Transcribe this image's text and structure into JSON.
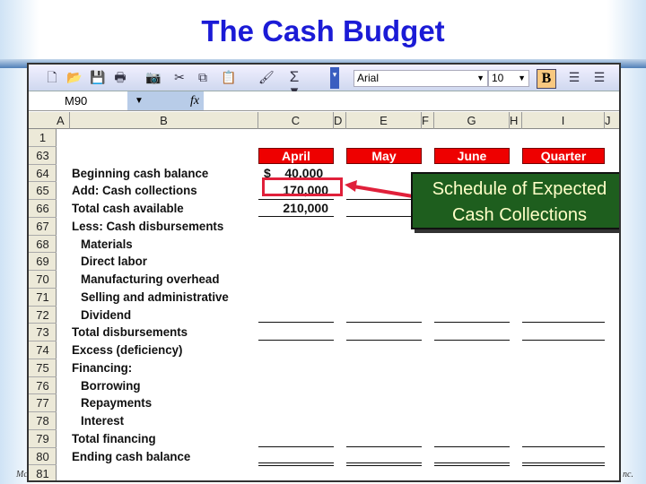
{
  "slide": {
    "title": "The Cash Budget",
    "footer_left": "Mc",
    "footer_right": "nc."
  },
  "toolbar": {
    "font": "Arial",
    "size": "10",
    "bold": "B",
    "icons": [
      "new-icon",
      "open-icon",
      "save-icon",
      "print-icon",
      "camera-icon",
      "cut-icon",
      "copy-icon",
      "paste-icon",
      "format-painter-icon",
      "sum-icon",
      "align-left-icon",
      "align-center-icon"
    ]
  },
  "formula_bar": {
    "name_box": "M90",
    "fx": "fx",
    "value": ""
  },
  "columns": [
    "A",
    "B",
    "C",
    "D",
    "E",
    "F",
    "G",
    "H",
    "I",
    "J"
  ],
  "rows": [
    "1",
    "63",
    "64",
    "65",
    "66",
    "67",
    "68",
    "69",
    "70",
    "71",
    "72",
    "73",
    "74",
    "75",
    "76",
    "77",
    "78",
    "79",
    "80",
    "81"
  ],
  "headers": [
    "April",
    "May",
    "June",
    "Quarter"
  ],
  "labels": [
    {
      "row": 64,
      "text": "Beginning cash balance",
      "indent": 0
    },
    {
      "row": 65,
      "text": "Add: Cash collections",
      "indent": 0
    },
    {
      "row": 66,
      "text": "Total cash available",
      "indent": 0
    },
    {
      "row": 67,
      "text": "Less: Cash disbursements",
      "indent": 0
    },
    {
      "row": 68,
      "text": "Materials",
      "indent": 1
    },
    {
      "row": 69,
      "text": "Direct labor",
      "indent": 1
    },
    {
      "row": 70,
      "text": "Manufacturing overhead",
      "indent": 1
    },
    {
      "row": 71,
      "text": "Selling and administrative",
      "indent": 1
    },
    {
      "row": 72,
      "text": "Dividend",
      "indent": 1
    },
    {
      "row": 73,
      "text": "Total disbursements",
      "indent": 0
    },
    {
      "row": 74,
      "text": "Excess (deficiency)",
      "indent": 0
    },
    {
      "row": 75,
      "text": "Financing:",
      "indent": 0
    },
    {
      "row": 76,
      "text": "Borrowing",
      "indent": 1
    },
    {
      "row": 77,
      "text": "Repayments",
      "indent": 1
    },
    {
      "row": 78,
      "text": "Interest",
      "indent": 1
    },
    {
      "row": 79,
      "text": "Total financing",
      "indent": 0
    },
    {
      "row": 80,
      "text": "Ending cash balance",
      "indent": 0
    }
  ],
  "april": {
    "beginning_cash": "$    40,000",
    "cash_collections": "170,000",
    "total_cash_available": "210,000"
  },
  "callout": {
    "line1": "Schedule of Expected",
    "line2": "Cash Collections",
    "bg": "#1e5e1e",
    "text_color": "#ffffc8"
  },
  "colors": {
    "header_red": "#ee0000",
    "highlight": "#e0203a",
    "title": "#1b1bd6"
  }
}
